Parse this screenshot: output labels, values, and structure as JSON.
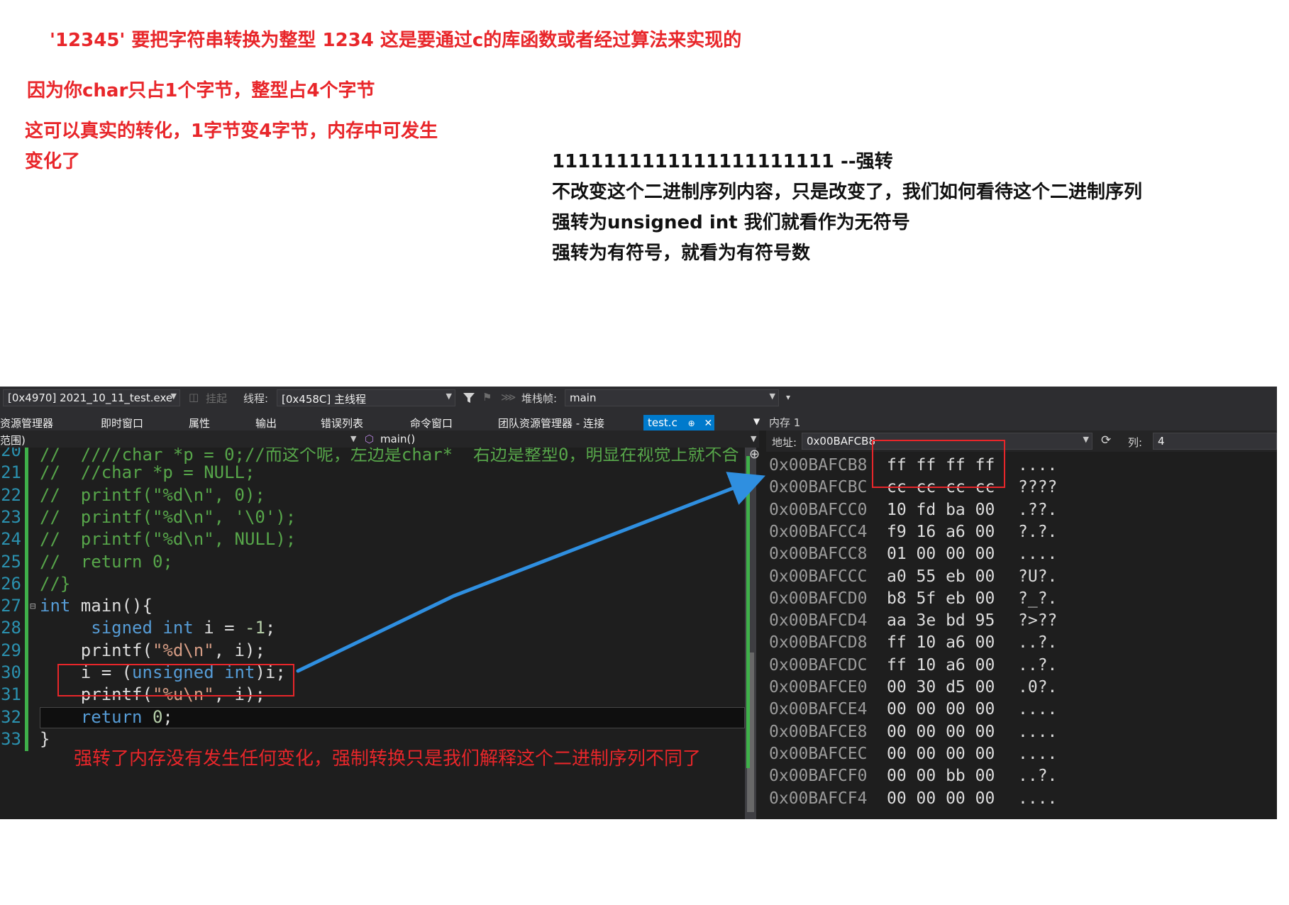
{
  "notes": {
    "line1": "'12345' 要把字符串转换为整型 1234    这是要通过c的库函数或者经过算法来实现的",
    "line2": "因为你char只占1个字节，整型占4个字节",
    "line3a": "这可以真实的转化，1字节变4字节，内存中可发生",
    "line3b": "变化了",
    "right1": "1111111111111111111111   --强转",
    "right2": "不改变这个二进制序列内容，只是改变了，我们如何看待这个二进制序列",
    "right3": "强转为unsigned int  我们就看作为无符号",
    "right4": "强转为有符号，就看为有符号数",
    "caption": "强转了内存没有发生任何变化，强制转换只是我们解释这个二进制序列不同了"
  },
  "debug_toolbar": {
    "process": "[0x4970] 2021_10_11_test.exe",
    "suspend": "挂起",
    "thread_label": "线程:",
    "thread": "[0x458C] 主线程",
    "stackframe_label": "堆栈帧:",
    "stackframe": "main"
  },
  "tabs": [
    "资源管理器",
    "即时窗口",
    "属性",
    "输出",
    "错误列表",
    "命令窗口",
    "团队资源管理器 - 连接"
  ],
  "active_tab": {
    "label": "test.c",
    "pin": "⊕",
    "close": "✕"
  },
  "nav": {
    "scope": "范围)",
    "function": "main()"
  },
  "code_lines": [
    {
      "n": "20",
      "tokens": [
        [
          "cmt",
          "//  ////char *p = 0;//而这个呢，左边是char*  右边是整型0，明显在视觉上就不合"
        ]
      ]
    },
    {
      "n": "21",
      "tokens": [
        [
          "cmt",
          "//  //char *p = NULL;"
        ]
      ]
    },
    {
      "n": "22",
      "tokens": [
        [
          "cmt",
          "//  printf(\"%d\\n\", 0);"
        ]
      ]
    },
    {
      "n": "23",
      "tokens": [
        [
          "cmt",
          "//  printf(\"%d\\n\", '\\0');"
        ]
      ]
    },
    {
      "n": "24",
      "tokens": [
        [
          "cmt",
          "//  printf(\"%d\\n\", NULL);"
        ]
      ]
    },
    {
      "n": "25",
      "tokens": [
        [
          "cmt",
          "//  return 0;"
        ]
      ]
    },
    {
      "n": "26",
      "tokens": [
        [
          "cmt",
          "//}"
        ]
      ]
    },
    {
      "n": "27",
      "tokens": [
        [
          "kw",
          "int"
        ],
        [
          "txt",
          " main(){"
        ]
      ]
    },
    {
      "n": "28",
      "tokens": [
        [
          "txt",
          "     "
        ],
        [
          "kw",
          "signed int"
        ],
        [
          "txt",
          " i = "
        ],
        [
          "num",
          "-1"
        ],
        [
          "txt",
          ";"
        ]
      ]
    },
    {
      "n": "29",
      "tokens": [
        [
          "txt",
          "    printf("
        ],
        [
          "str",
          "\"%d\\n\""
        ],
        [
          "txt",
          ", i);"
        ]
      ]
    },
    {
      "n": "30",
      "tokens": [
        [
          "txt",
          "    i = ("
        ],
        [
          "kw",
          "unsigned int"
        ],
        [
          "txt",
          ")i;"
        ]
      ]
    },
    {
      "n": "31",
      "tokens": [
        [
          "txt",
          "    printf("
        ],
        [
          "str",
          "\"%u\\n\""
        ],
        [
          "txt",
          ", i);"
        ]
      ]
    },
    {
      "n": "32",
      "tokens": [
        [
          "txt",
          "    "
        ],
        [
          "kw",
          "return"
        ],
        [
          "txt",
          " "
        ],
        [
          "num",
          "0"
        ],
        [
          "txt",
          ";"
        ]
      ]
    },
    {
      "n": "33",
      "tokens": [
        [
          "txt",
          "}"
        ]
      ]
    }
  ],
  "memory": {
    "title": "内存 1",
    "address_label": "地址:",
    "address_value": "0x00BAFCB8",
    "columns_label": "列:",
    "columns_value": "4",
    "rows": [
      {
        "addr": "0x00BAFCB8",
        "bytes": "ff ff ff ff",
        "ascii": "...."
      },
      {
        "addr": "0x00BAFCBC",
        "bytes": "cc cc cc cc",
        "ascii": "????"
      },
      {
        "addr": "0x00BAFCC0",
        "bytes": "10 fd ba 00",
        "ascii": ".??."
      },
      {
        "addr": "0x00BAFCC4",
        "bytes": "f9 16 a6 00",
        "ascii": "?.?."
      },
      {
        "addr": "0x00BAFCC8",
        "bytes": "01 00 00 00",
        "ascii": "...."
      },
      {
        "addr": "0x00BAFCCC",
        "bytes": "a0 55 eb 00",
        "ascii": "?U?."
      },
      {
        "addr": "0x00BAFCD0",
        "bytes": "b8 5f eb 00",
        "ascii": "?_?."
      },
      {
        "addr": "0x00BAFCD4",
        "bytes": "aa 3e bd 95",
        "ascii": "?>??"
      },
      {
        "addr": "0x00BAFCD8",
        "bytes": "ff 10 a6 00",
        "ascii": "..?."
      },
      {
        "addr": "0x00BAFCDC",
        "bytes": "ff 10 a6 00",
        "ascii": "..?."
      },
      {
        "addr": "0x00BAFCE0",
        "bytes": "00 30 d5 00",
        "ascii": ".0?."
      },
      {
        "addr": "0x00BAFCE4",
        "bytes": "00 00 00 00",
        "ascii": "...."
      },
      {
        "addr": "0x00BAFCE8",
        "bytes": "00 00 00 00",
        "ascii": "...."
      },
      {
        "addr": "0x00BAFCEC",
        "bytes": "00 00 00 00",
        "ascii": "...."
      },
      {
        "addr": "0x00BAFCF0",
        "bytes": "00 00 bb 00",
        "ascii": "..?."
      },
      {
        "addr": "0x00BAFCF4",
        "bytes": "00 00 00 00",
        "ascii": "...."
      }
    ]
  },
  "icons": [
    "filter-icon",
    "refresh-icon",
    "expand-icon",
    "dropdown-icon"
  ],
  "colors": {
    "annotation_red": "#e8262a",
    "arrow_blue": "#2f8fe0",
    "ide_bg": "#1e1e1e",
    "tab_blue": "#007acc"
  }
}
